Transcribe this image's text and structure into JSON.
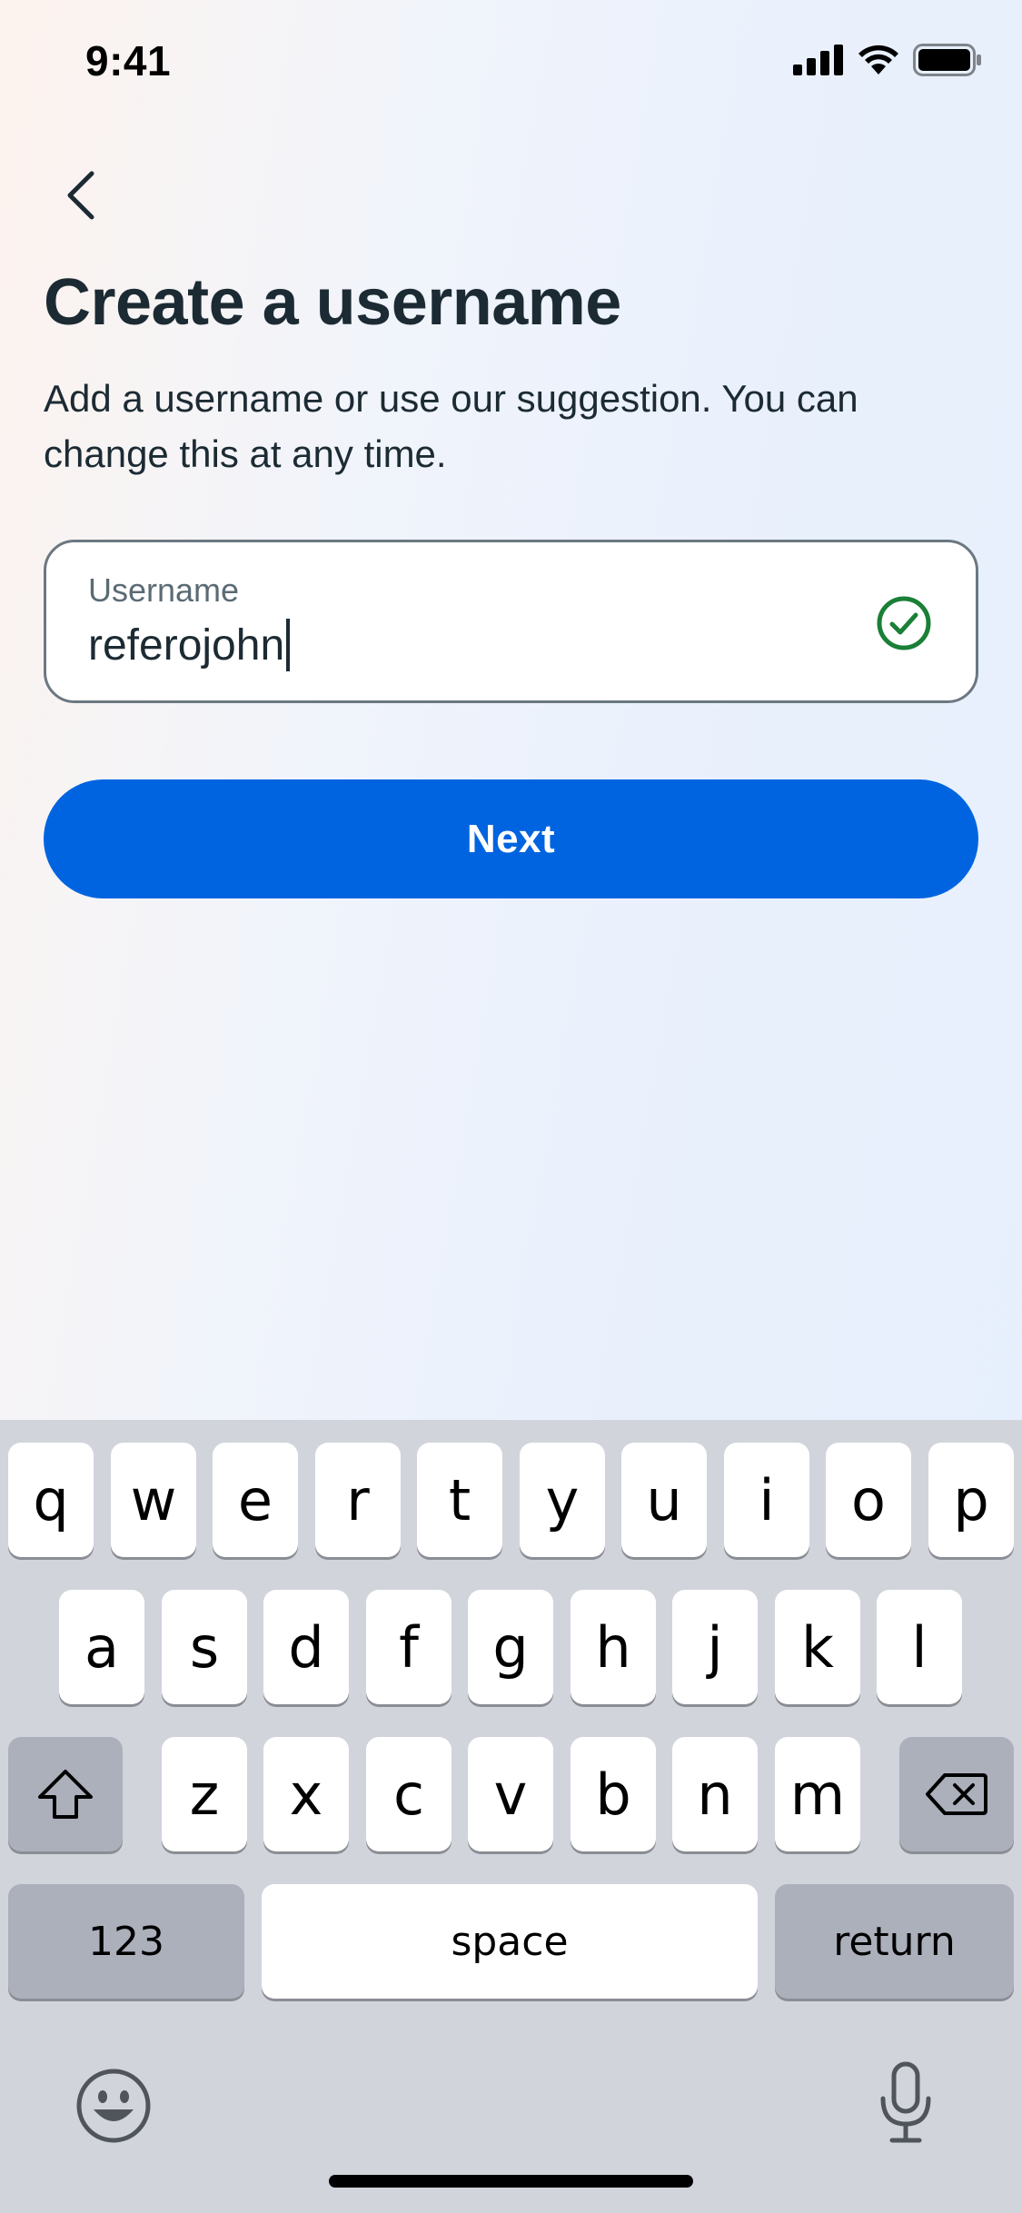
{
  "status_bar": {
    "time": "9:41"
  },
  "header": {
    "title": "Create a username",
    "subtitle": "Add a username or use our suggestion. You can change this at any time."
  },
  "username_field": {
    "label": "Username",
    "value": "referojohn",
    "valid": true
  },
  "next_button": {
    "label": "Next"
  },
  "keyboard": {
    "row1": [
      "q",
      "w",
      "e",
      "r",
      "t",
      "y",
      "u",
      "i",
      "o",
      "p"
    ],
    "row2": [
      "a",
      "s",
      "d",
      "f",
      "g",
      "h",
      "j",
      "k",
      "l"
    ],
    "row3": [
      "z",
      "x",
      "c",
      "v",
      "b",
      "n",
      "m"
    ],
    "numbers_label": "123",
    "space_label": "space",
    "return_label": "return"
  },
  "colors": {
    "primary": "#0064e0",
    "success": "#1a7f37",
    "text": "#1c2b33"
  },
  "icons": [
    "chevron-left-icon",
    "signal-icon",
    "wifi-icon",
    "battery-icon",
    "check-circle-icon",
    "shift-icon",
    "backspace-icon",
    "emoji-icon",
    "microphone-icon"
  ]
}
